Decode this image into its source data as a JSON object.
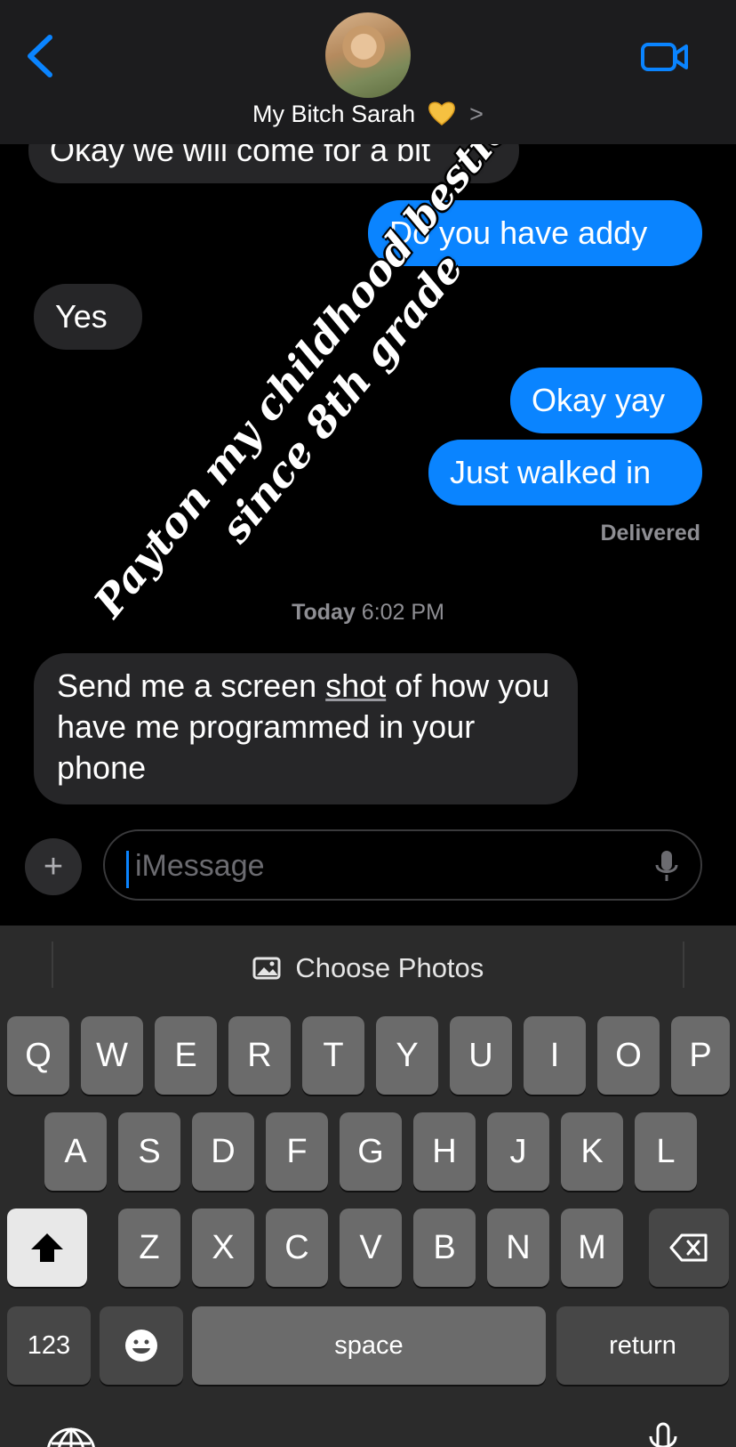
{
  "header": {
    "back_icon": "chevron-left-icon",
    "contact_name": "My Bitch Sarah",
    "contact_emoji": "yellow-heart-icon",
    "chevron": ">",
    "video_icon": "video-camera-icon",
    "accent_color": "#0a84ff"
  },
  "messages": [
    {
      "direction": "incoming",
      "text": "Okay we will come for a bit"
    },
    {
      "direction": "outgoing",
      "text": "Do you have addy"
    },
    {
      "direction": "incoming",
      "text": "Yes"
    },
    {
      "direction": "outgoing",
      "text": "Okay yay"
    },
    {
      "direction": "outgoing",
      "text": "Just walked in"
    }
  ],
  "status": {
    "delivered": "Delivered"
  },
  "timestamp": {
    "day": "Today",
    "time": "6:02 PM"
  },
  "last_message": {
    "direction": "incoming",
    "before": "Send me a screen ",
    "underlined": "shot",
    "after": " of how you have me programmed in your phone"
  },
  "overlay": {
    "line1": "Payton my childhood bestie",
    "line2": "since 8th grade"
  },
  "composer": {
    "plus": "+",
    "placeholder": "iMessage"
  },
  "keyboard": {
    "choose_photos": "Choose Photos",
    "row1": [
      "Q",
      "W",
      "E",
      "R",
      "T",
      "Y",
      "U",
      "I",
      "O",
      "P"
    ],
    "row2": [
      "A",
      "S",
      "D",
      "F",
      "G",
      "H",
      "J",
      "K",
      "L"
    ],
    "row3": [
      "Z",
      "X",
      "C",
      "V",
      "B",
      "N",
      "M"
    ],
    "numbers": "123",
    "space": "space",
    "return": "return"
  }
}
